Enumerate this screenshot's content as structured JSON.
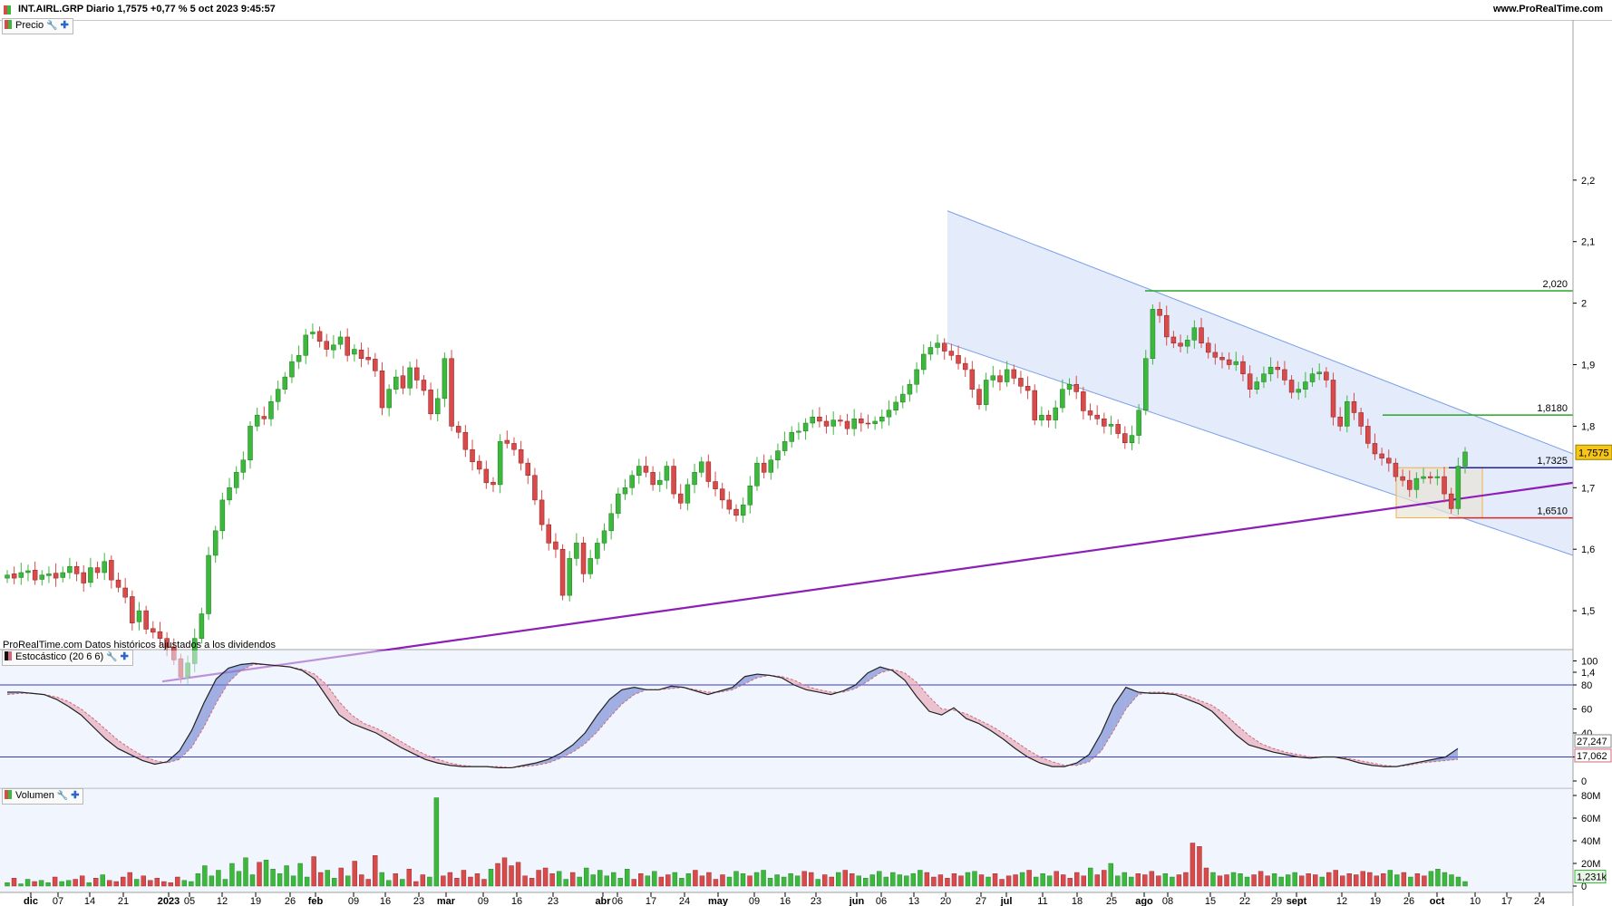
{
  "header": {
    "title": "INT.AIRL.GRP Diario 1,7575 +0,77 % 5 oct 2023 9:45:57",
    "site": "www.ProRealTime.com"
  },
  "panels": {
    "price_label": "Precio",
    "stoch_label": "Estocástico (20 6 6)",
    "volume_label": "Volumen",
    "note": "ProRealTime.com Datos históricos ajustados a los dividendos"
  },
  "colors": {
    "up": "#3cb83c",
    "down": "#d94b4b",
    "trendline": "#8c1fb5",
    "channel": "#dbe6fb",
    "stoch_fast": "#222222",
    "stoch_slow": "#d26a7c"
  },
  "icons": [
    "wrench-icon",
    "plus-icon"
  ],
  "chart_data": [
    {
      "type": "candlestick",
      "title": "INT.AIRL.GRP Diario",
      "last_value": "1,7575",
      "y_ticks": [
        "1,4",
        "1,5",
        "1,6",
        "1,7",
        "1,8",
        "1,9",
        "2",
        "2,1",
        "2,2"
      ],
      "ylim": [
        1.33,
        2.23
      ],
      "x_labels": [
        "dic",
        "07",
        "14",
        "21",
        "2023",
        "05",
        "12",
        "19",
        "26",
        "feb",
        "09",
        "16",
        "23",
        "mar",
        "09",
        "16",
        "23",
        "abr",
        "06",
        "17",
        "24",
        "may",
        "09",
        "16",
        "23",
        "jun",
        "06",
        "13",
        "20",
        "27",
        "jul",
        "11",
        "18",
        "25",
        "ago",
        "08",
        "15",
        "22",
        "29",
        "sept",
        "12",
        "19",
        "26",
        "oct",
        "10",
        "17",
        "24"
      ],
      "x_bold": [
        "dic",
        "2023",
        "feb",
        "mar",
        "abr",
        "may",
        "jun",
        "jul",
        "ago",
        "sept",
        "oct"
      ],
      "closes": [
        1.558,
        1.553,
        1.562,
        1.565,
        1.55,
        1.558,
        1.56,
        1.553,
        1.562,
        1.572,
        1.56,
        1.545,
        1.57,
        1.562,
        1.58,
        1.55,
        1.538,
        1.522,
        1.48,
        1.5,
        1.47,
        1.465,
        1.455,
        1.44,
        1.42,
        1.392,
        1.415,
        1.455,
        1.495,
        1.59,
        1.63,
        1.68,
        1.7,
        1.725,
        1.745,
        1.8,
        1.818,
        1.812,
        1.84,
        1.86,
        1.88,
        1.905,
        1.915,
        1.948,
        1.953,
        1.938,
        1.925,
        1.932,
        1.945,
        1.915,
        1.925,
        1.91,
        1.908,
        1.89,
        1.83,
        1.86,
        1.88,
        1.862,
        1.895,
        1.875,
        1.858,
        1.82,
        1.845,
        1.91,
        1.8,
        1.79,
        1.762,
        1.742,
        1.73,
        1.708,
        1.705,
        1.775,
        1.772,
        1.762,
        1.74,
        1.72,
        1.68,
        1.64,
        1.61,
        1.6,
        1.525,
        1.585,
        1.61,
        1.56,
        1.585,
        1.61,
        1.63,
        1.658,
        1.69,
        1.7,
        1.72,
        1.735,
        1.725,
        1.705,
        1.712,
        1.735,
        1.69,
        1.675,
        1.705,
        1.725,
        1.742,
        1.71,
        1.698,
        1.68,
        1.665,
        1.655,
        1.672,
        1.703,
        1.74,
        1.725,
        1.745,
        1.76,
        1.775,
        1.79,
        1.792,
        1.805,
        1.815,
        1.808,
        1.8,
        1.81,
        1.808,
        1.796,
        1.812,
        1.805,
        1.804,
        1.808,
        1.815,
        1.826,
        1.839,
        1.852,
        1.868,
        1.892,
        1.917,
        1.928,
        1.935,
        1.922,
        1.915,
        1.902,
        1.892,
        1.86,
        1.835,
        1.875,
        1.882,
        1.872,
        1.892,
        1.878,
        1.865,
        1.858,
        1.81,
        1.818,
        1.81,
        1.83,
        1.86,
        1.868,
        1.856,
        1.825,
        1.818,
        1.812,
        1.8,
        1.803,
        1.788,
        1.773,
        1.785,
        1.826,
        1.91,
        1.99,
        1.98,
        1.945,
        1.935,
        1.93,
        1.94,
        1.96,
        1.935,
        1.92,
        1.912,
        1.908,
        1.9,
        1.905,
        1.885,
        1.86,
        1.872,
        1.885,
        1.896,
        1.892,
        1.875,
        1.855,
        1.86,
        1.872,
        1.885,
        1.888,
        1.875,
        1.815,
        1.8,
        1.84,
        1.822,
        1.8,
        1.772,
        1.755,
        1.748,
        1.74,
        1.718,
        1.712,
        1.697,
        1.715,
        1.718,
        1.716,
        1.718,
        1.69,
        1.666,
        1.735,
        1.758
      ],
      "opens": [
        1.553,
        1.56,
        1.554,
        1.562,
        1.566,
        1.551,
        1.557,
        1.561,
        1.554,
        1.562,
        1.572,
        1.562,
        1.546,
        1.57,
        1.562,
        1.582,
        1.55,
        1.537,
        1.523,
        1.482,
        1.5,
        1.471,
        1.466,
        1.455,
        1.441,
        1.422,
        1.393,
        1.414,
        1.455,
        1.495,
        1.59,
        1.63,
        1.68,
        1.7,
        1.725,
        1.745,
        1.8,
        1.816,
        1.812,
        1.84,
        1.86,
        1.88,
        1.905,
        1.915,
        1.95,
        1.954,
        1.938,
        1.924,
        1.933,
        1.945,
        1.917,
        1.924,
        1.912,
        1.909,
        1.89,
        1.83,
        1.86,
        1.882,
        1.862,
        1.895,
        1.875,
        1.859,
        1.82,
        1.845,
        1.91,
        1.8,
        1.79,
        1.762,
        1.743,
        1.73,
        1.709,
        1.705,
        1.777,
        1.772,
        1.762,
        1.74,
        1.72,
        1.68,
        1.64,
        1.612,
        1.6,
        1.525,
        1.585,
        1.61,
        1.56,
        1.585,
        1.61,
        1.63,
        1.658,
        1.69,
        1.7,
        1.72,
        1.735,
        1.725,
        1.705,
        1.712,
        1.735,
        1.69,
        1.675,
        1.705,
        1.725,
        1.742,
        1.71,
        1.698,
        1.68,
        1.665,
        1.655,
        1.672,
        1.703,
        1.74,
        1.725,
        1.745,
        1.76,
        1.775,
        1.79,
        1.792,
        1.805,
        1.815,
        1.808,
        1.8,
        1.81,
        1.808,
        1.796,
        1.812,
        1.805,
        1.804,
        1.808,
        1.815,
        1.826,
        1.839,
        1.852,
        1.868,
        1.892,
        1.917,
        1.928,
        1.935,
        1.922,
        1.915,
        1.902,
        1.892,
        1.86,
        1.835,
        1.875,
        1.882,
        1.872,
        1.892,
        1.878,
        1.865,
        1.858,
        1.81,
        1.818,
        1.81,
        1.83,
        1.86,
        1.868,
        1.856,
        1.825,
        1.818,
        1.812,
        1.8,
        1.803,
        1.788,
        1.773,
        1.785,
        1.826,
        1.91,
        1.99,
        1.98,
        1.945,
        1.935,
        1.93,
        1.94,
        1.96,
        1.935,
        1.92,
        1.912,
        1.908,
        1.9,
        1.905,
        1.885,
        1.86,
        1.872,
        1.885,
        1.896,
        1.892,
        1.875,
        1.855,
        1.86,
        1.872,
        1.885,
        1.888,
        1.875,
        1.815,
        1.8,
        1.84,
        1.822,
        1.8,
        1.772,
        1.755,
        1.748,
        1.74,
        1.718,
        1.712,
        1.697,
        1.715,
        1.718,
        1.716,
        1.718,
        1.69,
        1.666,
        1.735,
        1.755
      ],
      "channel": {
        "top_start": 2.15,
        "top_end": 1.755,
        "bottom_start": 1.935,
        "bottom_end": 1.59
      },
      "trendline": {
        "start": 1.385,
        "end": 1.708
      },
      "levels": [
        {
          "label": "2,020",
          "value": 2.02,
          "color": "#2aa52a"
        },
        {
          "label": "1,8180",
          "value": 1.818,
          "color": "#2aa52a"
        },
        {
          "label": "1,7325",
          "value": 1.7325,
          "color": "#1f1fa0"
        },
        {
          "label": "1,6510",
          "value": 1.651,
          "color": "#d42a2a"
        }
      ]
    },
    {
      "type": "line",
      "title": "Estocástico (20 6 6)",
      "y_ticks": [
        "0",
        "20",
        "40",
        "60",
        "80",
        "100"
      ],
      "ylim": [
        0,
        105
      ],
      "levels": [
        80,
        20
      ],
      "last_fast": "27,247",
      "last_slow": "17,062",
      "fast": [
        74,
        74,
        73,
        72,
        68,
        62,
        55,
        45,
        35,
        27,
        22,
        17,
        14,
        16,
        25,
        42,
        65,
        85,
        94,
        97,
        98,
        97,
        96,
        95,
        92,
        85,
        70,
        55,
        48,
        44,
        40,
        34,
        28,
        23,
        18,
        15,
        13,
        12,
        12,
        12,
        11,
        11,
        13,
        15,
        18,
        23,
        30,
        40,
        55,
        68,
        76,
        78,
        76,
        76,
        79,
        78,
        75,
        72,
        75,
        78,
        87,
        89,
        88,
        86,
        80,
        76,
        74,
        72,
        75,
        80,
        90,
        95,
        92,
        84,
        70,
        58,
        55,
        61,
        52,
        48,
        42,
        35,
        27,
        20,
        15,
        12,
        12,
        15,
        22,
        40,
        63,
        78,
        74,
        73,
        73,
        72,
        68,
        64,
        58,
        48,
        38,
        30,
        27,
        24,
        22,
        20,
        19,
        20,
        20,
        18,
        15,
        13,
        12,
        12,
        14,
        16,
        18,
        20,
        27
      ],
      "slow": [
        72,
        73,
        73,
        72,
        70,
        66,
        60,
        52,
        43,
        34,
        27,
        21,
        17,
        15,
        18,
        28,
        45,
        65,
        82,
        92,
        97,
        97,
        96,
        95,
        93,
        89,
        80,
        66,
        55,
        48,
        44,
        39,
        33,
        27,
        22,
        18,
        15,
        13,
        12,
        12,
        12,
        11,
        12,
        13,
        15,
        19,
        24,
        31,
        41,
        53,
        64,
        72,
        76,
        76,
        77,
        78,
        76,
        74,
        74,
        76,
        81,
        86,
        88,
        87,
        84,
        79,
        76,
        74,
        74,
        77,
        83,
        90,
        93,
        90,
        82,
        70,
        60,
        59,
        56,
        51,
        46,
        40,
        33,
        26,
        20,
        16,
        13,
        13,
        16,
        25,
        42,
        60,
        72,
        74,
        74,
        73,
        71,
        67,
        63,
        56,
        47,
        38,
        31,
        27,
        24,
        22,
        20,
        20,
        20,
        19,
        17,
        15,
        13,
        12,
        13,
        15,
        16,
        17,
        18
      ]
    },
    {
      "type": "bar",
      "title": "Volumen",
      "y_ticks": [
        "0",
        "20M",
        "40M",
        "60M",
        "80M"
      ],
      "ylim": [
        0,
        85
      ],
      "last_value": "1,231k",
      "volumes": [
        3,
        7,
        2,
        6,
        4,
        5,
        3,
        8,
        4,
        5,
        6,
        9,
        3,
        7,
        10,
        5,
        4,
        8,
        12,
        6,
        9,
        5,
        7,
        4,
        3,
        8,
        5,
        4,
        11,
        18,
        9,
        14,
        6,
        20,
        13,
        25,
        10,
        21,
        23,
        15,
        11,
        18,
        9,
        20,
        8,
        26,
        12,
        14,
        7,
        16,
        9,
        22,
        10,
        6,
        27,
        12,
        5,
        11,
        6,
        15,
        4,
        10,
        8,
        78,
        9,
        12,
        7,
        14,
        8,
        11,
        6,
        15,
        20,
        25,
        18,
        21,
        9,
        7,
        14,
        16,
        11,
        13,
        6,
        12,
        8,
        16,
        10,
        14,
        9,
        12,
        7,
        15,
        6,
        11,
        9,
        13,
        8,
        10,
        12,
        7,
        11,
        14,
        9,
        12,
        6,
        10,
        8,
        13,
        11,
        9,
        12,
        14,
        7,
        10,
        8,
        11,
        9,
        13,
        12,
        6,
        10,
        8,
        12,
        14,
        11,
        9,
        7,
        10,
        13,
        8,
        12,
        10,
        9,
        11,
        14,
        12,
        8,
        10,
        7,
        11,
        9,
        12,
        13,
        10,
        8,
        11,
        6,
        9,
        10,
        12,
        14,
        8,
        11,
        9,
        13,
        10,
        7,
        12,
        9,
        16,
        10,
        14,
        20,
        9,
        12,
        8,
        11,
        10,
        13,
        9,
        11,
        8,
        10,
        12,
        38,
        35,
        16,
        12,
        9,
        10,
        12,
        11,
        8,
        10,
        13,
        9,
        11,
        8,
        10,
        12,
        9,
        11,
        10,
        8,
        12,
        14,
        9,
        11,
        10,
        13,
        12,
        9,
        11,
        14,
        10,
        12,
        8,
        11,
        9,
        13,
        15,
        12,
        10,
        8,
        4
      ]
    }
  ]
}
